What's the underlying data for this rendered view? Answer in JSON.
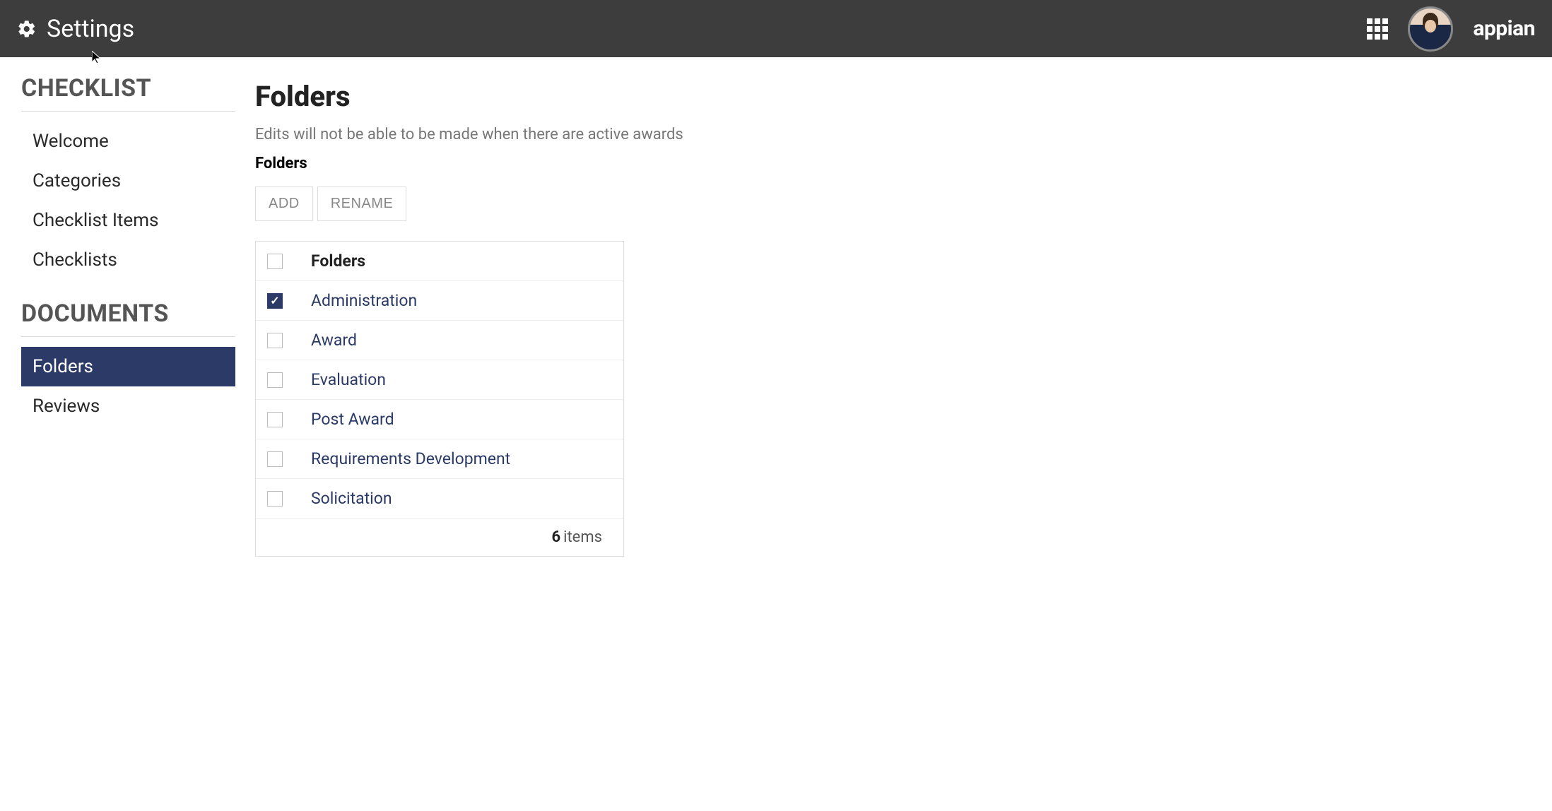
{
  "header": {
    "title": "Settings",
    "logo": "appian"
  },
  "sidebar": {
    "sections": [
      {
        "heading": "CHECKLIST",
        "items": [
          {
            "label": "Welcome",
            "active": false
          },
          {
            "label": "Categories",
            "active": false
          },
          {
            "label": "Checklist Items",
            "active": false
          },
          {
            "label": "Checklists",
            "active": false
          }
        ]
      },
      {
        "heading": "DOCUMENTS",
        "items": [
          {
            "label": "Folders",
            "active": true
          },
          {
            "label": "Reviews",
            "active": false
          }
        ]
      }
    ]
  },
  "main": {
    "title": "Folders",
    "subtitle": "Edits will not be able to be made when there are active awards",
    "section_label": "Folders",
    "toolbar": {
      "add_label": "ADD",
      "rename_label": "RENAME"
    },
    "table": {
      "column_header": "Folders",
      "rows": [
        {
          "name": "Administration",
          "checked": true
        },
        {
          "name": "Award",
          "checked": false
        },
        {
          "name": "Evaluation",
          "checked": false
        },
        {
          "name": "Post Award",
          "checked": false
        },
        {
          "name": "Requirements Development",
          "checked": false
        },
        {
          "name": "Solicitation",
          "checked": false
        }
      ],
      "footer_count": "6",
      "footer_label": "items"
    }
  }
}
